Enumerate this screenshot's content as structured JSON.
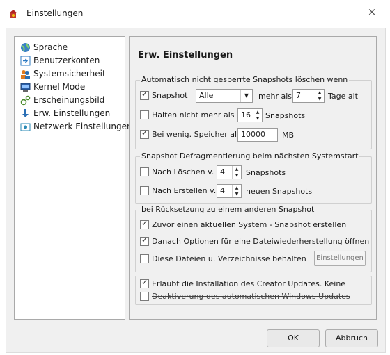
{
  "window": {
    "title": "Einstellungen",
    "close_glyph": "×"
  },
  "sidebar": {
    "items": [
      {
        "label": "Sprache",
        "icon": "globe-icon"
      },
      {
        "label": "Benutzerkonten",
        "icon": "user-accounts-icon"
      },
      {
        "label": "Systemsicherheit",
        "icon": "security-icon"
      },
      {
        "label": "Kernel Mode",
        "icon": "kernel-icon"
      },
      {
        "label": "Erscheinungsbild",
        "icon": "appearance-icon"
      },
      {
        "label": "Erw. Einstellungen",
        "icon": "advanced-icon"
      },
      {
        "label": "Netzwerk Einstellungen",
        "icon": "network-icon"
      }
    ]
  },
  "content": {
    "heading": "Erw. Einstellungen",
    "group1": {
      "title": "Automatisch nicht gesperrte Snapshots löschen wenn",
      "snapshot": {
        "label": "Snapshot",
        "checked": true,
        "combo": "Alle",
        "mehr_als": "mehr als",
        "days": "7",
        "days_label": "Tage alt"
      },
      "halten": {
        "label": "Halten nicht mehr als",
        "checked": false,
        "count": "16",
        "count_label": "Snapshots"
      },
      "speicher": {
        "label": "Bei wenig. Speicher als",
        "checked": true,
        "value": "10000",
        "unit": "MB"
      }
    },
    "group2": {
      "title": "Snapshot Defragmentierung beim nächsten Systemstart",
      "loeschen": {
        "label": "Nach Löschen v.",
        "checked": false,
        "count": "4",
        "suffix": "Snapshots"
      },
      "erstellen": {
        "label": "Nach Erstellen v.",
        "checked": false,
        "count": "4",
        "suffix": "neuen Snapshots"
      }
    },
    "group3": {
      "title": "bei Rücksetzung zu einem anderen Snapshot",
      "zuvor": {
        "label": "Zuvor einen aktuellen System - Snapshot erstellen",
        "checked": true
      },
      "danach": {
        "label": "Danach Optionen für eine Dateiwiederherstellung öffnen",
        "checked": true
      },
      "behalten": {
        "label": "Diese Dateien u. Verzeichnisse behalten",
        "checked": false,
        "button": "Einstellungen"
      }
    },
    "group4": {
      "creator": {
        "label": "Erlaubt die Installation des Creator Updates. Keine",
        "checked": true
      },
      "deaktivierung": {
        "label": "Deaktiverung des automatischen Windows Updates",
        "checked": false
      }
    }
  },
  "footer": {
    "ok": "OK",
    "cancel": "Abbruch"
  }
}
